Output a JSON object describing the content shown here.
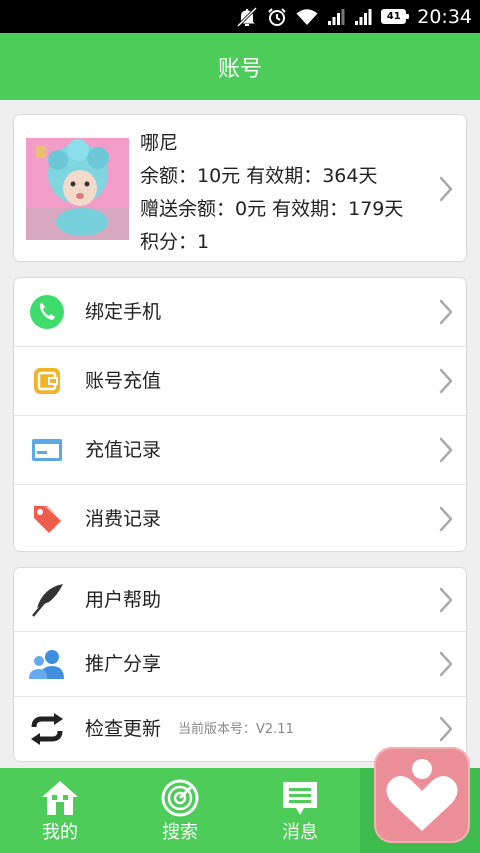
{
  "status_bar": {
    "time": "20:34",
    "battery": "41"
  },
  "header": {
    "title": "账号"
  },
  "profile": {
    "name": "哪尼",
    "balance_line": "余额：10元  有效期：364天",
    "gift_line": "赠送余额：0元  有效期：179天",
    "points_line": "积分：1"
  },
  "menu_group_1": [
    {
      "label": "绑定手机",
      "icon": "phone-icon"
    },
    {
      "label": "账号充值",
      "icon": "wallet-icon"
    },
    {
      "label": "充值记录",
      "icon": "card-icon"
    },
    {
      "label": "消费记录",
      "icon": "tag-icon"
    }
  ],
  "menu_group_2": [
    {
      "label": "用户帮助",
      "icon": "feather-icon"
    },
    {
      "label": "推广分享",
      "icon": "users-icon"
    },
    {
      "label": "检查更新",
      "icon": "refresh-icon",
      "sub": "当前版本号：V2.11"
    }
  ],
  "tab_bar": [
    {
      "label": "我的",
      "icon": "home-icon"
    },
    {
      "label": "搜索",
      "icon": "radar-icon"
    },
    {
      "label": "消息",
      "icon": "message-icon"
    },
    {
      "label": "",
      "icon": "heart-icon"
    }
  ],
  "colors": {
    "primary": "#4dcc59",
    "floating_button": "#ec8e97"
  }
}
